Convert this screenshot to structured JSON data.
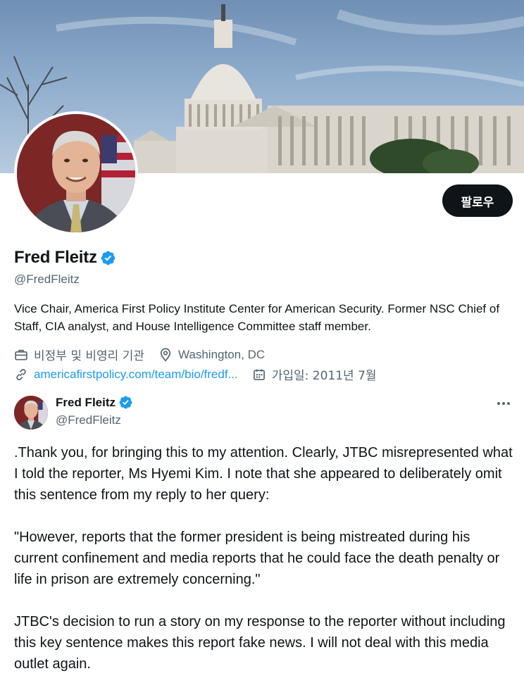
{
  "profile": {
    "follow_label": "팔로우",
    "display_name": "Fred Fleitz",
    "handle": "@FredFleitz",
    "bio": "Vice Chair, America First Policy Institute Center for American Security.  Former NSC Chief of Staff, CIA analyst, and House Intelligence Committee staff member.",
    "category": "비정부 및 비영리 기관",
    "location": "Washington, DC",
    "website": "americafirstpolicy.com/team/bio/fredf...",
    "joined": "가입일: 2011년 7월"
  },
  "tweet": {
    "author_name": "Fred Fleitz",
    "author_handle": "@FredFleitz",
    "paragraphs": [
      ".Thank you, for bringing this to my attention. Clearly, JTBC misrepresented what I told the reporter, Ms Hyemi Kim.  I note that she appeared to deliberately omit this sentence from my reply to her query:",
      "\"However, reports that the former president is being mistreated during his current confinement and media reports that he could face the death penalty or life in prison are extremely concerning.\"",
      "JTBC's decision to run a story on my response to the reporter without including this key sentence makes this report fake news.  I will not deal with this media outlet again."
    ]
  },
  "icons": {
    "verified": "verified-badge-icon",
    "category": "briefcase-icon",
    "location": "location-pin-icon",
    "website": "link-icon",
    "joined": "calendar-icon",
    "more": "more-dots-icon"
  },
  "colors": {
    "accent": "#1d9bf0",
    "secondary_text": "#536471",
    "primary_text": "#0f1419"
  }
}
